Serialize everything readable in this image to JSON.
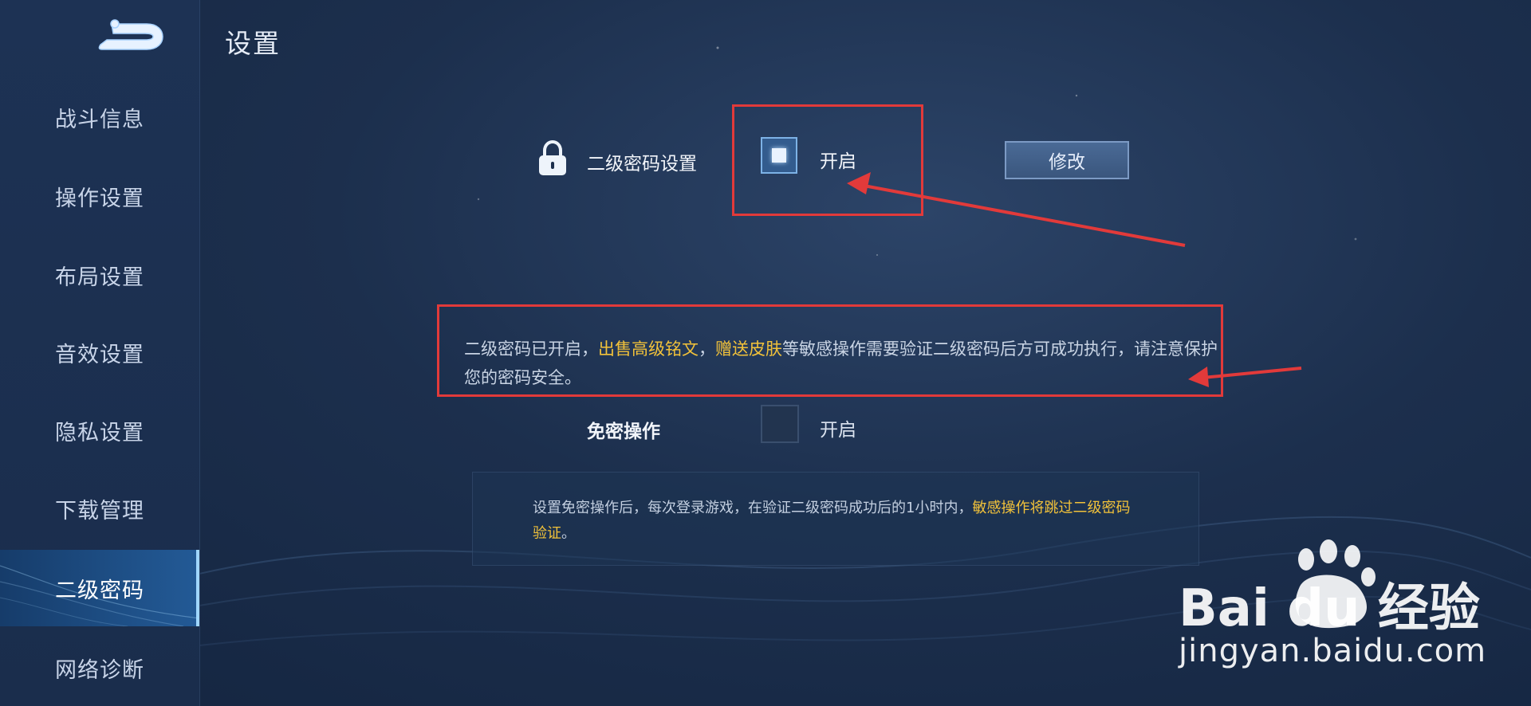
{
  "header": {
    "title": "设置"
  },
  "sidebar": {
    "items": [
      {
        "label": "战斗信息"
      },
      {
        "label": "操作设置"
      },
      {
        "label": "布局设置"
      },
      {
        "label": "音效设置"
      },
      {
        "label": "隐私设置"
      },
      {
        "label": "下载管理"
      },
      {
        "label": "二级密码",
        "active": true
      },
      {
        "label": "网络诊断"
      }
    ]
  },
  "secondary_password": {
    "label": "二级密码设置",
    "toggle_label": "开启",
    "checked": true,
    "modify_label": "修改",
    "info": {
      "part1": "二级密码已开启，",
      "highlight1": "出售高级铭文",
      "sep": "，",
      "highlight2": "赠送皮肤",
      "part2": "等敏感操作需要验证二级密码后方可成功执行，请注意保护您的密码安全。"
    }
  },
  "password_free": {
    "label": "免密操作",
    "toggle_label": "开启",
    "checked": false,
    "info": {
      "part1": "设置免密操作后，每次登录游戏，在验证二级密码成功后的1小时内，",
      "highlight": "敏感操作将跳过二级密码验证",
      "part2": "。"
    }
  },
  "watermark": {
    "brand": "Bai du 经验",
    "url": "jingyan.baidu.com"
  },
  "colors": {
    "highlight": "#f2c23a",
    "annotation": "#e23a3a",
    "active_accent": "#9fd6ff"
  }
}
